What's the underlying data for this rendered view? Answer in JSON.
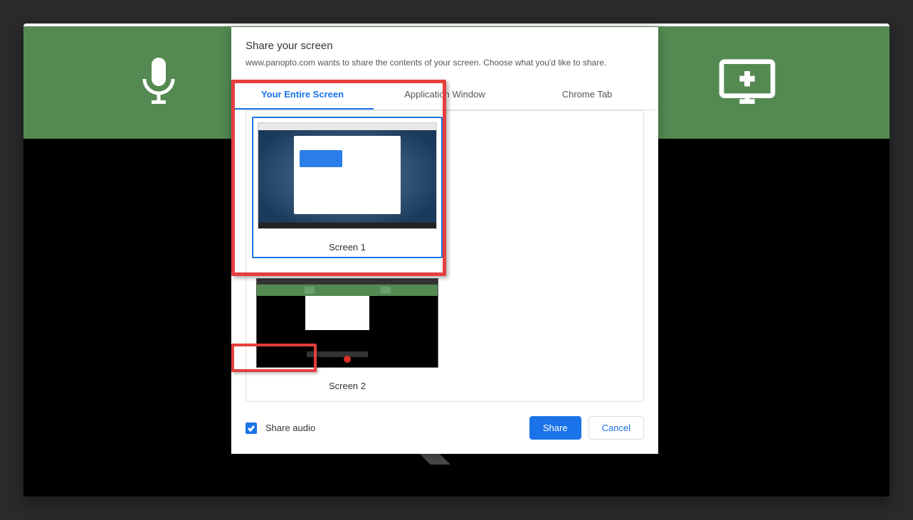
{
  "dialog": {
    "title": "Share your screen",
    "subtitle": "www.panopto.com wants to share the contents of your screen. Choose what you'd like to share."
  },
  "tabs": {
    "entire_screen": "Your Entire Screen",
    "app_window": "Application Window",
    "chrome_tab": "Chrome Tab"
  },
  "screens": {
    "screen1_label": "Screen 1",
    "screen2_label": "Screen 2"
  },
  "footer": {
    "share_audio": "Share audio",
    "share_btn": "Share",
    "cancel_btn": "Cancel"
  }
}
